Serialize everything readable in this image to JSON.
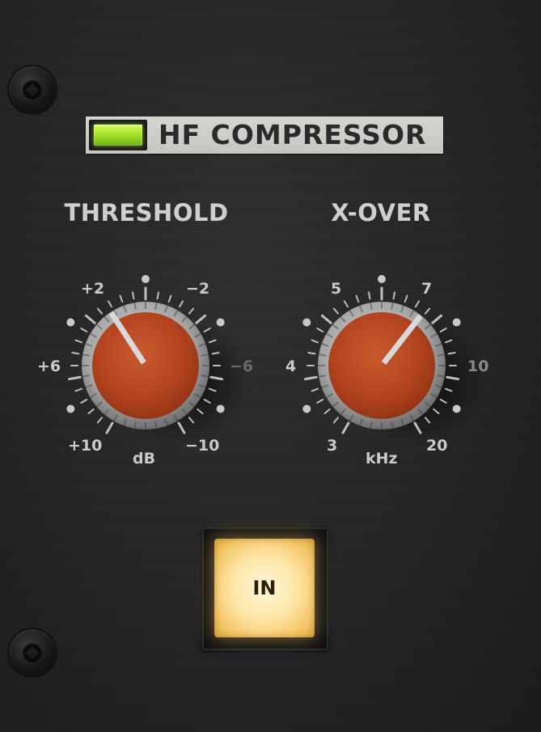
{
  "title": "HF COMPRESSOR",
  "threshold": {
    "label": "THRESHOLD",
    "unit": "dB",
    "scale": {
      "top_left": "+2",
      "top_right": "−2",
      "left": "+6",
      "right": "−6",
      "bottom_left": "+10",
      "bottom_right": "−10"
    }
  },
  "xover": {
    "label": "X-OVER",
    "unit": "kHz",
    "scale": {
      "top_left": "5",
      "top_right": "7",
      "left": "4",
      "right": "10",
      "bottom_left": "3",
      "bottom_right": "20"
    }
  },
  "in_button": {
    "label": "IN",
    "state": "on"
  },
  "colors": {
    "panel": "#232325",
    "knob_cap": "#b3441f",
    "knob_skirt": "#a9a9a9",
    "led": "#a6e42c",
    "button_glow": "#ffe6a8"
  },
  "icons": [
    "screw-icon",
    "led-indicator"
  ]
}
